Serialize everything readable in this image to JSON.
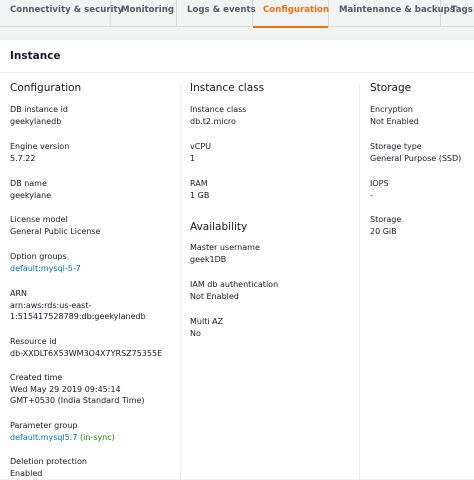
{
  "tabs": [
    {
      "label": "Connectivity & security"
    },
    {
      "label": "Monitoring"
    },
    {
      "label": "Logs & events"
    },
    {
      "label": "Configuration"
    },
    {
      "label": "Maintenance & backups"
    },
    {
      "label": "Tags"
    }
  ],
  "active_tab": "Configuration",
  "accent_color": "#ec7211",
  "link_color": "#0073bb",
  "panel": {
    "title": "Instance"
  },
  "configuration": {
    "title": "Configuration",
    "db_instance_id": {
      "label": "DB instance id",
      "value": "geekylanedb"
    },
    "engine_version": {
      "label": "Engine version",
      "value": "5.7.22"
    },
    "db_name": {
      "label": "DB name",
      "value": "geekylane"
    },
    "license_model": {
      "label": "License model",
      "value": "General Public License"
    },
    "option_groups": {
      "label": "Option groups",
      "value": "default:mysql-5-7"
    },
    "arn": {
      "label": "ARN",
      "value": "arn:aws:rds:us-east-1:515417528789:db:geekylanedb"
    },
    "resource_id": {
      "label": "Resource id",
      "value": "db-XXDLT6X53WM3O4X7YRSZ75355E"
    },
    "created_time": {
      "label": "Created time",
      "value": "Wed May 29 2019 09:45:14 GMT+0530 (India Standard Time)"
    },
    "parameter_group": {
      "label": "Parameter group",
      "value": "default.mysql5.7",
      "status": "(in-sync)"
    },
    "deletion_protection": {
      "label": "Deletion protection",
      "value": "Enabled"
    }
  },
  "instance_class": {
    "title": "Instance class",
    "instance_class": {
      "label": "Instance class",
      "value": "db.t2.micro"
    },
    "vcpu": {
      "label": "vCPU",
      "value": "1"
    },
    "ram": {
      "label": "RAM",
      "value": "1 GB"
    }
  },
  "availability": {
    "title": "Availability",
    "master_username": {
      "label": "Master username",
      "value": "geek1DB"
    },
    "iam_auth": {
      "label": "IAM db authentication",
      "value": "Not Enabled"
    },
    "multi_az": {
      "label": "Multi AZ",
      "value": "No"
    }
  },
  "storage": {
    "title": "Storage",
    "encryption": {
      "label": "Encryption",
      "value": "Not Enabled"
    },
    "storage_type": {
      "label": "Storage type",
      "value": "General Purpose (SSD)"
    },
    "iops": {
      "label": "IOPS",
      "value": "-"
    },
    "storage": {
      "label": "Storage",
      "value": "20 GiB"
    }
  }
}
